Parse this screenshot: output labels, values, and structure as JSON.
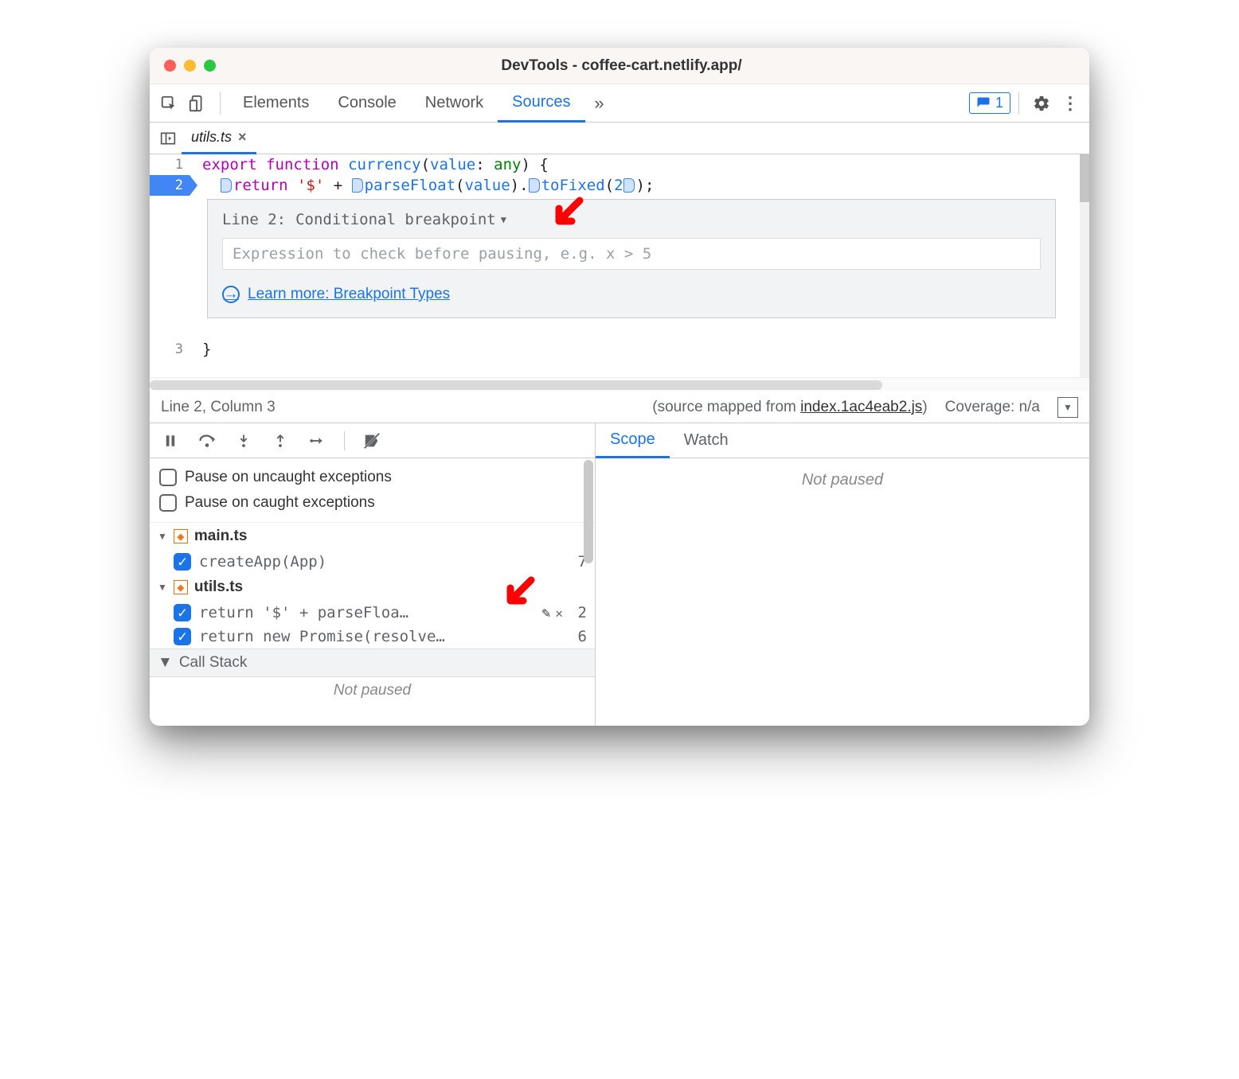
{
  "window": {
    "title": "DevTools - coffee-cart.netlify.app/"
  },
  "main_tabs": {
    "items": [
      "Elements",
      "Console",
      "Network",
      "Sources"
    ],
    "active_index": 3,
    "overflow_glyph": "»",
    "issues_count": "1"
  },
  "file_tab": {
    "name": "utils.ts",
    "close_glyph": "×"
  },
  "code": {
    "line1": {
      "export": "export",
      "function": "function",
      "fn": "currency",
      "open": "(",
      "param": "value",
      "colon": ": ",
      "type": "any",
      "close": ") {"
    },
    "line2": {
      "return": "return",
      "str": " '$' ",
      "plus": "+ ",
      "parseFloat": "parseFloat",
      "open": "(",
      "value": "value",
      "close": ").",
      "toFixed": "toFixed",
      "open2": "(",
      "num": "2",
      "close2": ");"
    },
    "line3": "}"
  },
  "bp_popup": {
    "line_label": "Line 2:",
    "type": "Conditional breakpoint",
    "placeholder": "Expression to check before pausing, e.g. x > 5",
    "learn_more": "Learn more: Breakpoint Types",
    "arrow_glyph": "→"
  },
  "status": {
    "pos": "Line 2, Column 3",
    "mapped_prefix": "(source mapped from ",
    "mapped_link": "index.1ac4eab2.js",
    "mapped_suffix": ")",
    "coverage": "Coverage: n/a",
    "toggle_glyph": "▼"
  },
  "pause": {
    "uncaught": "Pause on uncaught exceptions",
    "caught": "Pause on caught exceptions"
  },
  "breakpoints": {
    "files": [
      {
        "name": "main.ts",
        "items": [
          {
            "code": "createApp(App)",
            "line": "7",
            "checked": true,
            "hover": false
          }
        ]
      },
      {
        "name": "utils.ts",
        "items": [
          {
            "code": "return '$' + parseFloa…",
            "line": "2",
            "checked": true,
            "hover": true
          },
          {
            "code": "return new Promise(resolve…",
            "line": "6",
            "checked": true,
            "hover": false
          }
        ]
      }
    ],
    "call_stack_label": "Call Stack",
    "not_paused": "Not paused"
  },
  "right": {
    "tabs": [
      "Scope",
      "Watch"
    ],
    "active_index": 0,
    "not_paused": "Not paused"
  },
  "gutter": {
    "l1": "1",
    "l2": "2",
    "l3": "3"
  },
  "icons": {
    "check": "✓",
    "caret_down": "▼",
    "pencil": "✎",
    "x": "✕"
  }
}
